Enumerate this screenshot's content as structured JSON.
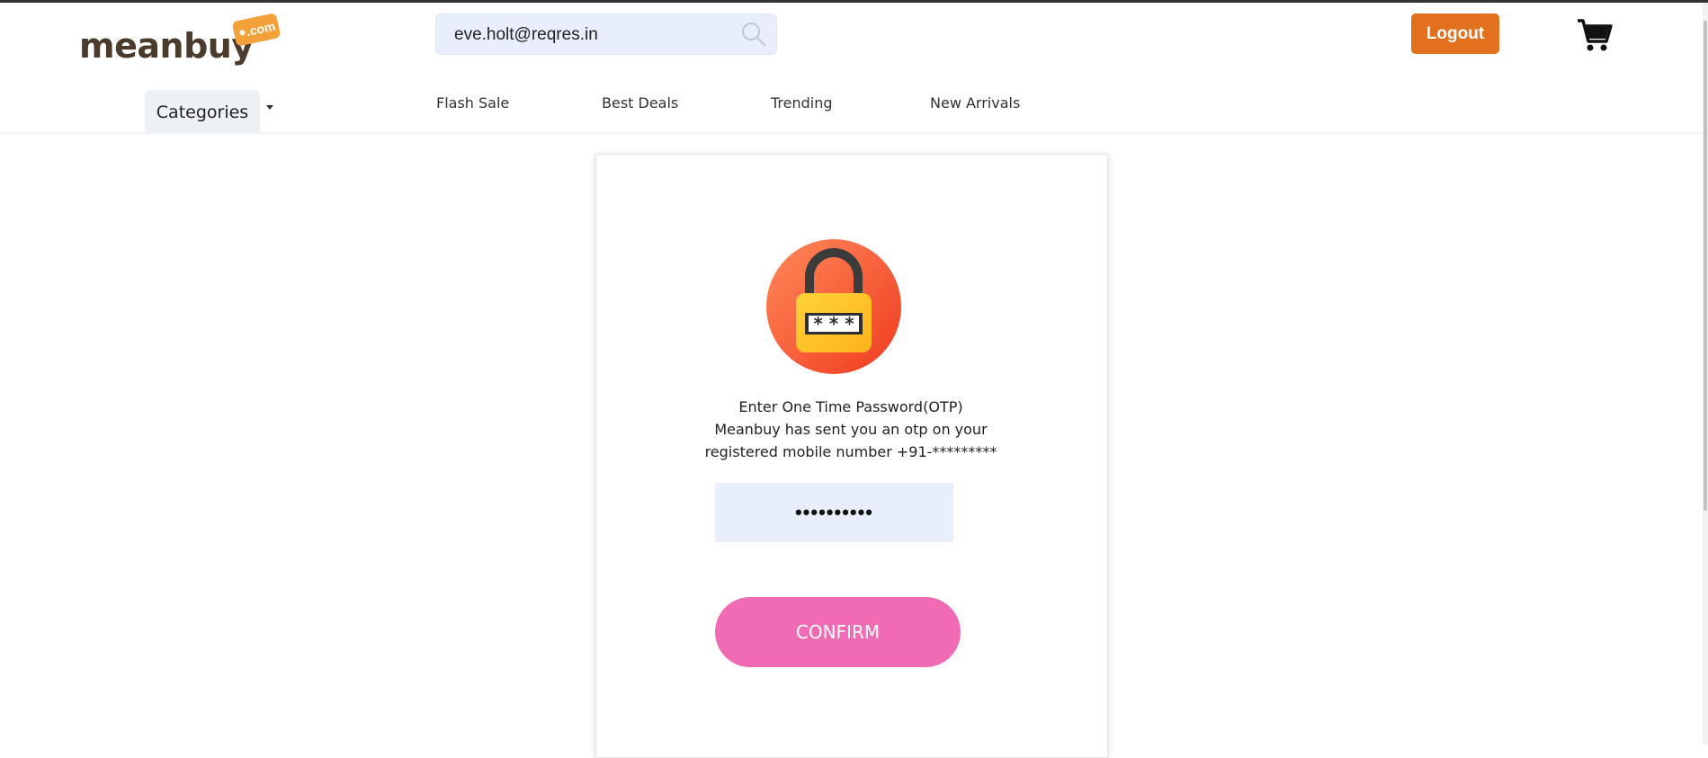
{
  "header": {
    "logo_text": "meanbuy",
    "logo_tag": ".com",
    "search_value": "eve.holt@reqres.in",
    "search_placeholder": "",
    "logout_label": "Logout",
    "cart_icon": "shopping-cart-icon"
  },
  "nav": {
    "categories_label": "Categories",
    "links": [
      "Flash Sale",
      "Best Deals",
      "Trending",
      "New Arrivals"
    ]
  },
  "otp": {
    "lock_icon": "padlock-password-icon",
    "title": "Enter One Time Password(OTP)",
    "message_line1": "Meanbuy has sent you an otp on your",
    "message_line2": "registered mobile number +91-*********",
    "input_value": "••••••••••",
    "confirm_label": "CONFIRM"
  },
  "colors": {
    "logout": "#e2701d",
    "confirm": "#f06bb3",
    "input_bg": "#e8eefb",
    "lock_circle": "#ff5a36"
  }
}
